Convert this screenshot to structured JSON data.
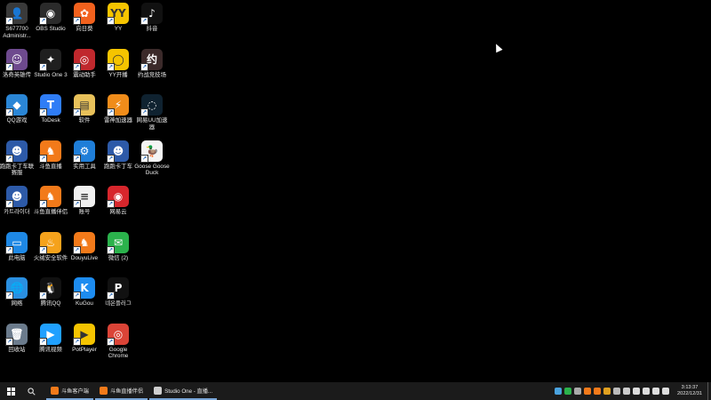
{
  "desktop": {
    "icons": [
      {
        "label": "S677700 Administr...",
        "icon": "admin-user-icon",
        "color": "#3a3a3a",
        "glyph": "👤"
      },
      {
        "label": "OBS Studio",
        "icon": "obs-icon",
        "color": "#2b2b2b",
        "glyph": "◉"
      },
      {
        "label": "向日葵",
        "icon": "sunflower-icon",
        "color": "#f2611d",
        "glyph": "✿"
      },
      {
        "label": "YY",
        "icon": "yy-icon",
        "color": "#f5c400",
        "glyph": "YY"
      },
      {
        "label": "抖音",
        "icon": "douyin-icon",
        "color": "#111111",
        "glyph": "♪"
      },
      {
        "label": "洛奇英雄传",
        "icon": "game-icon",
        "color": "#6e4a8e",
        "glyph": "☺"
      },
      {
        "label": "Studio One 3",
        "icon": "studio-one-icon",
        "color": "#1f1f1f",
        "glyph": "✦"
      },
      {
        "label": "震动助手",
        "icon": "vibration-helper-icon",
        "color": "#c0282d",
        "glyph": "◎"
      },
      {
        "label": "YY开播",
        "icon": "yy-live-icon",
        "color": "#f5c400",
        "glyph": "◯"
      },
      {
        "label": "约战竞技场",
        "icon": "arena-icon",
        "color": "#3b2a2a",
        "glyph": "约"
      },
      {
        "label": "QQ游戏",
        "icon": "qq-game-icon",
        "color": "#2a86d6",
        "glyph": "◆"
      },
      {
        "label": "ToDesk",
        "icon": "todesk-icon",
        "color": "#2f7df6",
        "glyph": "T"
      },
      {
        "label": "软件",
        "icon": "folder-icon",
        "color": "#e8c15a",
        "glyph": "▤"
      },
      {
        "label": "雷神加速器",
        "icon": "leishen-icon",
        "color": "#f08c1a",
        "glyph": "⚡"
      },
      {
        "label": "网易UU加速器",
        "icon": "uu-accelerator-icon",
        "color": "#0f2230",
        "glyph": "◌"
      },
      {
        "label": "跑跑卡丁车联赛服",
        "icon": "kartrider-icon",
        "color": "#2d5aa8",
        "glyph": "☻"
      },
      {
        "label": "斗鱼直播",
        "icon": "douyu-icon",
        "color": "#f27a1a",
        "glyph": "♞"
      },
      {
        "label": "实用工具",
        "icon": "tools-icon",
        "color": "#1f7ed8",
        "glyph": "⚙"
      },
      {
        "label": "跑跑卡丁车",
        "icon": "kartrider-icon",
        "color": "#2d5aa8",
        "glyph": "☻"
      },
      {
        "label": "Goose Goose Duck",
        "icon": "goose-icon",
        "color": "#f4f4f4",
        "glyph": "🦆"
      },
      {
        "label": "카트라이더",
        "icon": "kartrider-kr-icon",
        "color": "#2d5aa8",
        "glyph": "☻"
      },
      {
        "label": "斗鱼直播伴侣",
        "icon": "douyu-companion-icon",
        "color": "#f27a1a",
        "glyph": "♞"
      },
      {
        "label": "账号",
        "icon": "text-document-icon",
        "color": "#f0f0f0",
        "glyph": "≡"
      },
      {
        "label": "网易云",
        "icon": "netease-music-icon",
        "color": "#d7262c",
        "glyph": "◉"
      },
      {
        "label": "",
        "icon": "",
        "color": "",
        "glyph": ""
      },
      {
        "label": "此电脑",
        "icon": "this-pc-icon",
        "color": "#1e88e5",
        "glyph": "▭"
      },
      {
        "label": "火绒安全软件",
        "icon": "huorong-icon",
        "color": "#f5a21c",
        "glyph": "♨"
      },
      {
        "label": "DouyuLive",
        "icon": "douyu-live-icon",
        "color": "#f27a1a",
        "glyph": "♞"
      },
      {
        "label": "微信 (2)",
        "icon": "wechat-icon",
        "color": "#2bb24c",
        "glyph": "✉"
      },
      {
        "label": "",
        "icon": "",
        "color": "",
        "glyph": ""
      },
      {
        "label": "网络",
        "icon": "network-icon",
        "color": "#2a8fe0",
        "glyph": "🌐"
      },
      {
        "label": "腾讯QQ",
        "icon": "qq-icon",
        "color": "#111111",
        "glyph": "🐧"
      },
      {
        "label": "KuGou",
        "icon": "kugou-icon",
        "color": "#1d8cf0",
        "glyph": "K"
      },
      {
        "label": "네온플러그",
        "icon": "neonplug-icon",
        "color": "#111111",
        "glyph": "P"
      },
      {
        "label": "",
        "icon": "",
        "color": "",
        "glyph": ""
      },
      {
        "label": "回收站",
        "icon": "recycle-bin-icon",
        "color": "#6b7b8c",
        "glyph": "🗑"
      },
      {
        "label": "腾讯视频",
        "icon": "tencent-video-icon",
        "color": "#20a0ff",
        "glyph": "▶"
      },
      {
        "label": "PotPlayer",
        "icon": "potplayer-icon",
        "color": "#f5c400",
        "glyph": "▶"
      },
      {
        "label": "Google Chrome",
        "icon": "chrome-icon",
        "color": "#db4437",
        "glyph": "◎"
      }
    ]
  },
  "taskbar": {
    "apps": [
      {
        "label": "斗鱼客户端",
        "icon": "douyu-icon",
        "color": "#f27a1a"
      },
      {
        "label": "斗鱼直播伴侣",
        "icon": "douyu-companion-icon",
        "color": "#f27a1a"
      },
      {
        "label": "Studio One - 直播...",
        "icon": "studio-one-icon",
        "color": "#cfcfcf"
      }
    ],
    "tray": [
      {
        "icon": "tray-app-icon",
        "color": "#4aa3df"
      },
      {
        "icon": "tray-wechat-icon",
        "color": "#2bb24c"
      },
      {
        "icon": "tray-cloud-icon",
        "color": "#aaaaaa"
      },
      {
        "icon": "tray-app-icon",
        "color": "#f27a1a"
      },
      {
        "icon": "tray-app-icon",
        "color": "#f27a1a"
      },
      {
        "icon": "tray-app-icon",
        "color": "#e0a020"
      },
      {
        "icon": "tray-app-icon",
        "color": "#bbbbbb"
      },
      {
        "icon": "tray-network-icon",
        "color": "#cccccc"
      },
      {
        "icon": "tray-shield-icon",
        "color": "#dddddd"
      },
      {
        "icon": "tray-mic-icon",
        "color": "#dddddd"
      },
      {
        "icon": "tray-volume-icon",
        "color": "#dddddd"
      },
      {
        "icon": "tray-ime-icon",
        "color": "#dddddd"
      }
    ],
    "clock": {
      "time": "3:13:37",
      "date": "2022/12/31"
    }
  }
}
